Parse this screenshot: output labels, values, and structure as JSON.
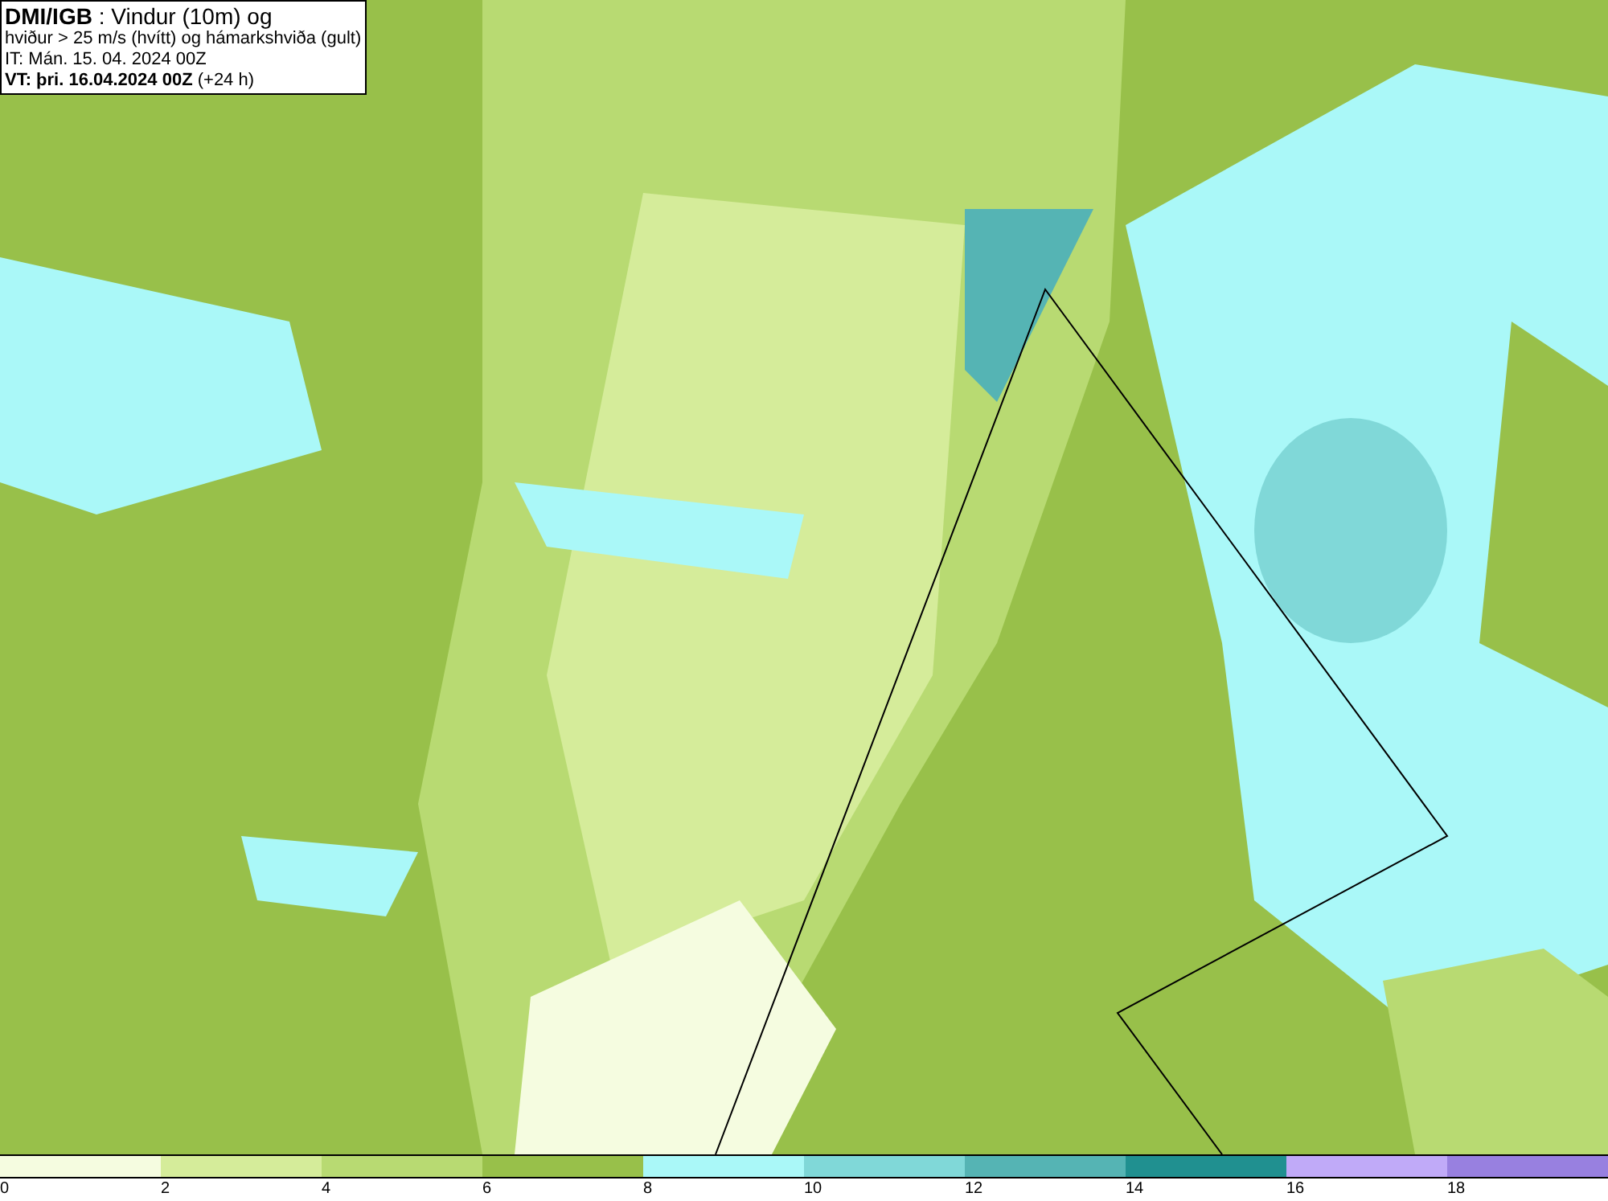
{
  "header": {
    "lines": [
      "**DMI/IGB** : Vindur (10m) og",
      "hviður > 25 m/s (hvítt) og hámarkshviða (gult)",
      "IT: Mán. 15. 04. 2024 00Z",
      "**VT: þri. 16.04.2024 00Z** (+24 h)"
    ]
  },
  "legend": {
    "bins": [
      {
        "color": "#f5fce0",
        "label": "0"
      },
      {
        "color": "#d5ec9a",
        "label": "2"
      },
      {
        "color": "#b8da72",
        "label": "4"
      },
      {
        "color": "#98c04a",
        "label": "6"
      },
      {
        "color": "#aaf8f8",
        "label": "8"
      },
      {
        "color": "#80d8d8",
        "label": "10"
      },
      {
        "color": "#55b4b4",
        "label": "12"
      },
      {
        "color": "#209090",
        "label": "14"
      },
      {
        "color": "#c0aaf8",
        "label": "16"
      },
      {
        "color": "#9880e0",
        "label": "18"
      }
    ]
  }
}
